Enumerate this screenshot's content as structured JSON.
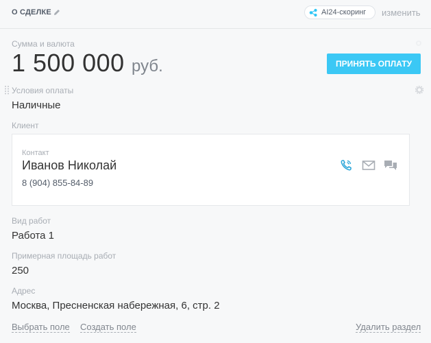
{
  "header": {
    "title": "О СДЕЛКЕ",
    "ai_badge": "AI24-скоринг",
    "change_link": "изменить"
  },
  "amount": {
    "label": "Сумма и валюта",
    "value": "1 500 000",
    "currency": "руб.",
    "pay_button": "ПРИНЯТЬ ОПЛАТУ"
  },
  "payment_terms": {
    "label": "Условия оплаты",
    "value": "Наличные"
  },
  "client": {
    "label": "Клиент",
    "card_label": "Контакт",
    "name": "Иванов Николай",
    "phone": "8 (904) 855-84-89"
  },
  "work_type": {
    "label": "Вид работ",
    "value": "Работа 1"
  },
  "area": {
    "label": "Примерная площадь работ",
    "value": "250"
  },
  "address": {
    "label": "Адрес",
    "value": "Москва, Пресненская набережная, 6, стр. 2"
  },
  "footer": {
    "select_field": "Выбрать поле",
    "create_field": "Создать поле",
    "delete_section": "Удалить раздел"
  },
  "colors": {
    "accent": "#3bc8f5",
    "icon_blue": "#2fa7d9",
    "icon_grey": "#a8adb4"
  },
  "icons": [
    "pencil-icon",
    "ai-scoring-icon",
    "gear-icon",
    "drag-handle-icon",
    "phone-icon",
    "mail-icon",
    "chat-icon"
  ]
}
